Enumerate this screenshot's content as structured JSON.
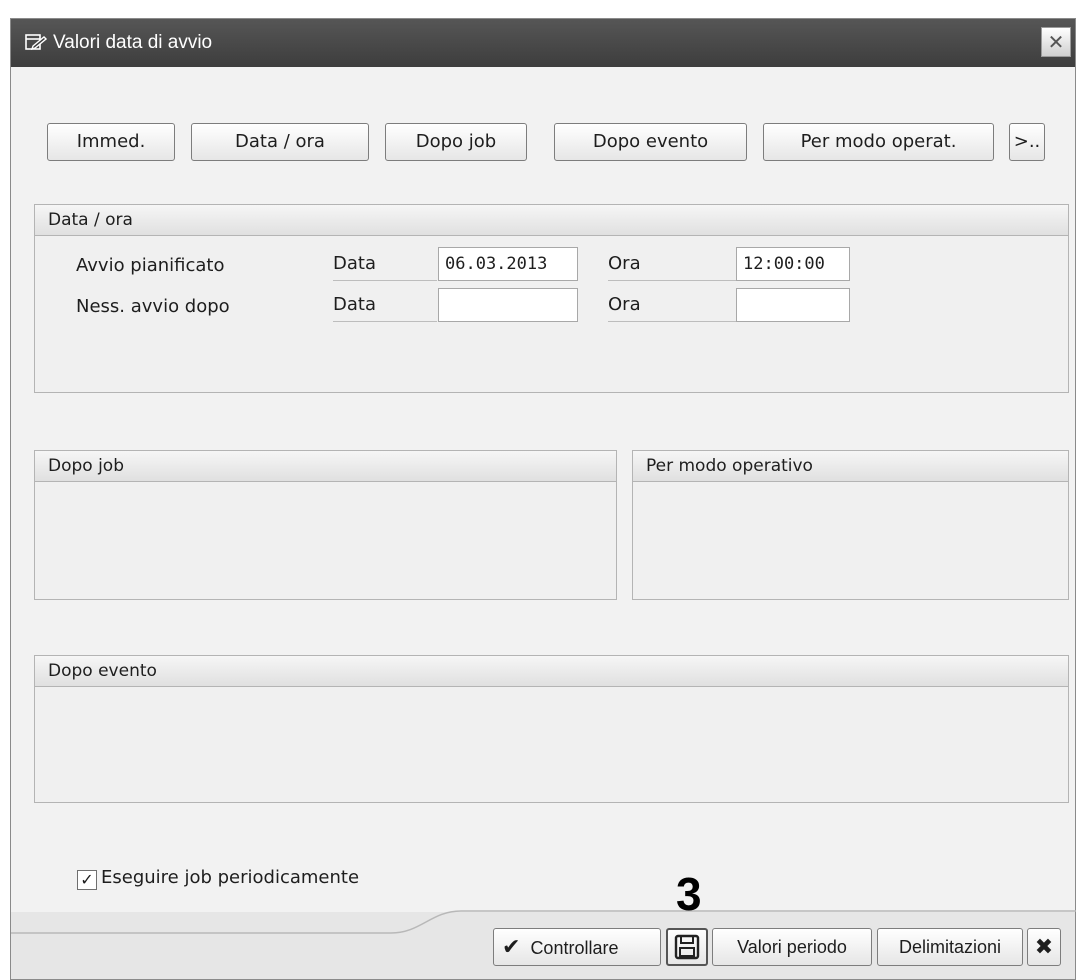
{
  "window": {
    "title": "Valori data di avvio",
    "title_icon": "edit-window-icon",
    "close_symbol": "✕"
  },
  "toolbar": {
    "immed": "Immed.",
    "data_ora": "Data / ora",
    "dopo_job": "Dopo job",
    "dopo_evento": "Dopo evento",
    "per_modo": "Per modo operat.",
    "more": ">.."
  },
  "data_ora_group": {
    "title": "Data / ora",
    "rows": [
      {
        "label": "Avvio pianificato",
        "date_label": "Data",
        "date_value": "06.03.2013",
        "time_label": "Ora",
        "time_value": "12:00:00"
      },
      {
        "label": "Ness. avvio dopo",
        "date_label": "Data",
        "date_value": "",
        "time_label": "Ora",
        "time_value": ""
      }
    ]
  },
  "dopo_job_group": {
    "title": "Dopo job"
  },
  "per_modo_group": {
    "title": "Per modo operativo"
  },
  "dopo_evento_group": {
    "title": "Dopo evento"
  },
  "periodic": {
    "checked": true,
    "check_symbol": "✓",
    "label": "Eseguire job periodicamente"
  },
  "footer": {
    "check_label": "Controllare",
    "valori_periodo": "Valori periodo",
    "delimitazioni": "Delimitazioni",
    "cancel_symbol": "✖"
  },
  "annotation": {
    "step_number": "3"
  }
}
